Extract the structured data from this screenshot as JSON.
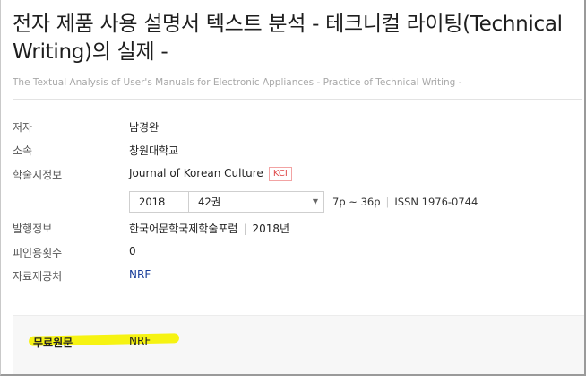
{
  "article": {
    "title": "전자 제품 사용 설명서 텍스트 분석 - 테크니컬 라이팅(Technical Writing)의 실제 -",
    "subtitle": "The Textual Analysis of User's Manuals for Electronic Appliances - Practice of Technical Writing -"
  },
  "info": {
    "author_label": "저자",
    "author": "남경완",
    "affiliation_label": "소속",
    "affiliation": "창원대학교",
    "journal_label": "학술지정보",
    "journal": "Journal of Korean Culture",
    "journal_badge": "KCI",
    "year": "2018",
    "volume": "42권",
    "pages": "7p ~ 36p",
    "issn": "ISSN 1976-0744",
    "publisher_label": "발행정보",
    "publisher": "한국어문학국제학술포럼",
    "publish_year": "2018년",
    "citations_label": "피인용횟수",
    "citations": "0",
    "source_label": "자료제공처",
    "source": "NRF"
  },
  "free": {
    "label": "무료원문",
    "value": "NRF"
  },
  "colors": {
    "highlight": "#f6f205",
    "link": "#1a3f9a",
    "badge": "#e04b4b"
  },
  "icons": {
    "select_arrow": "chevron-down-icon"
  }
}
